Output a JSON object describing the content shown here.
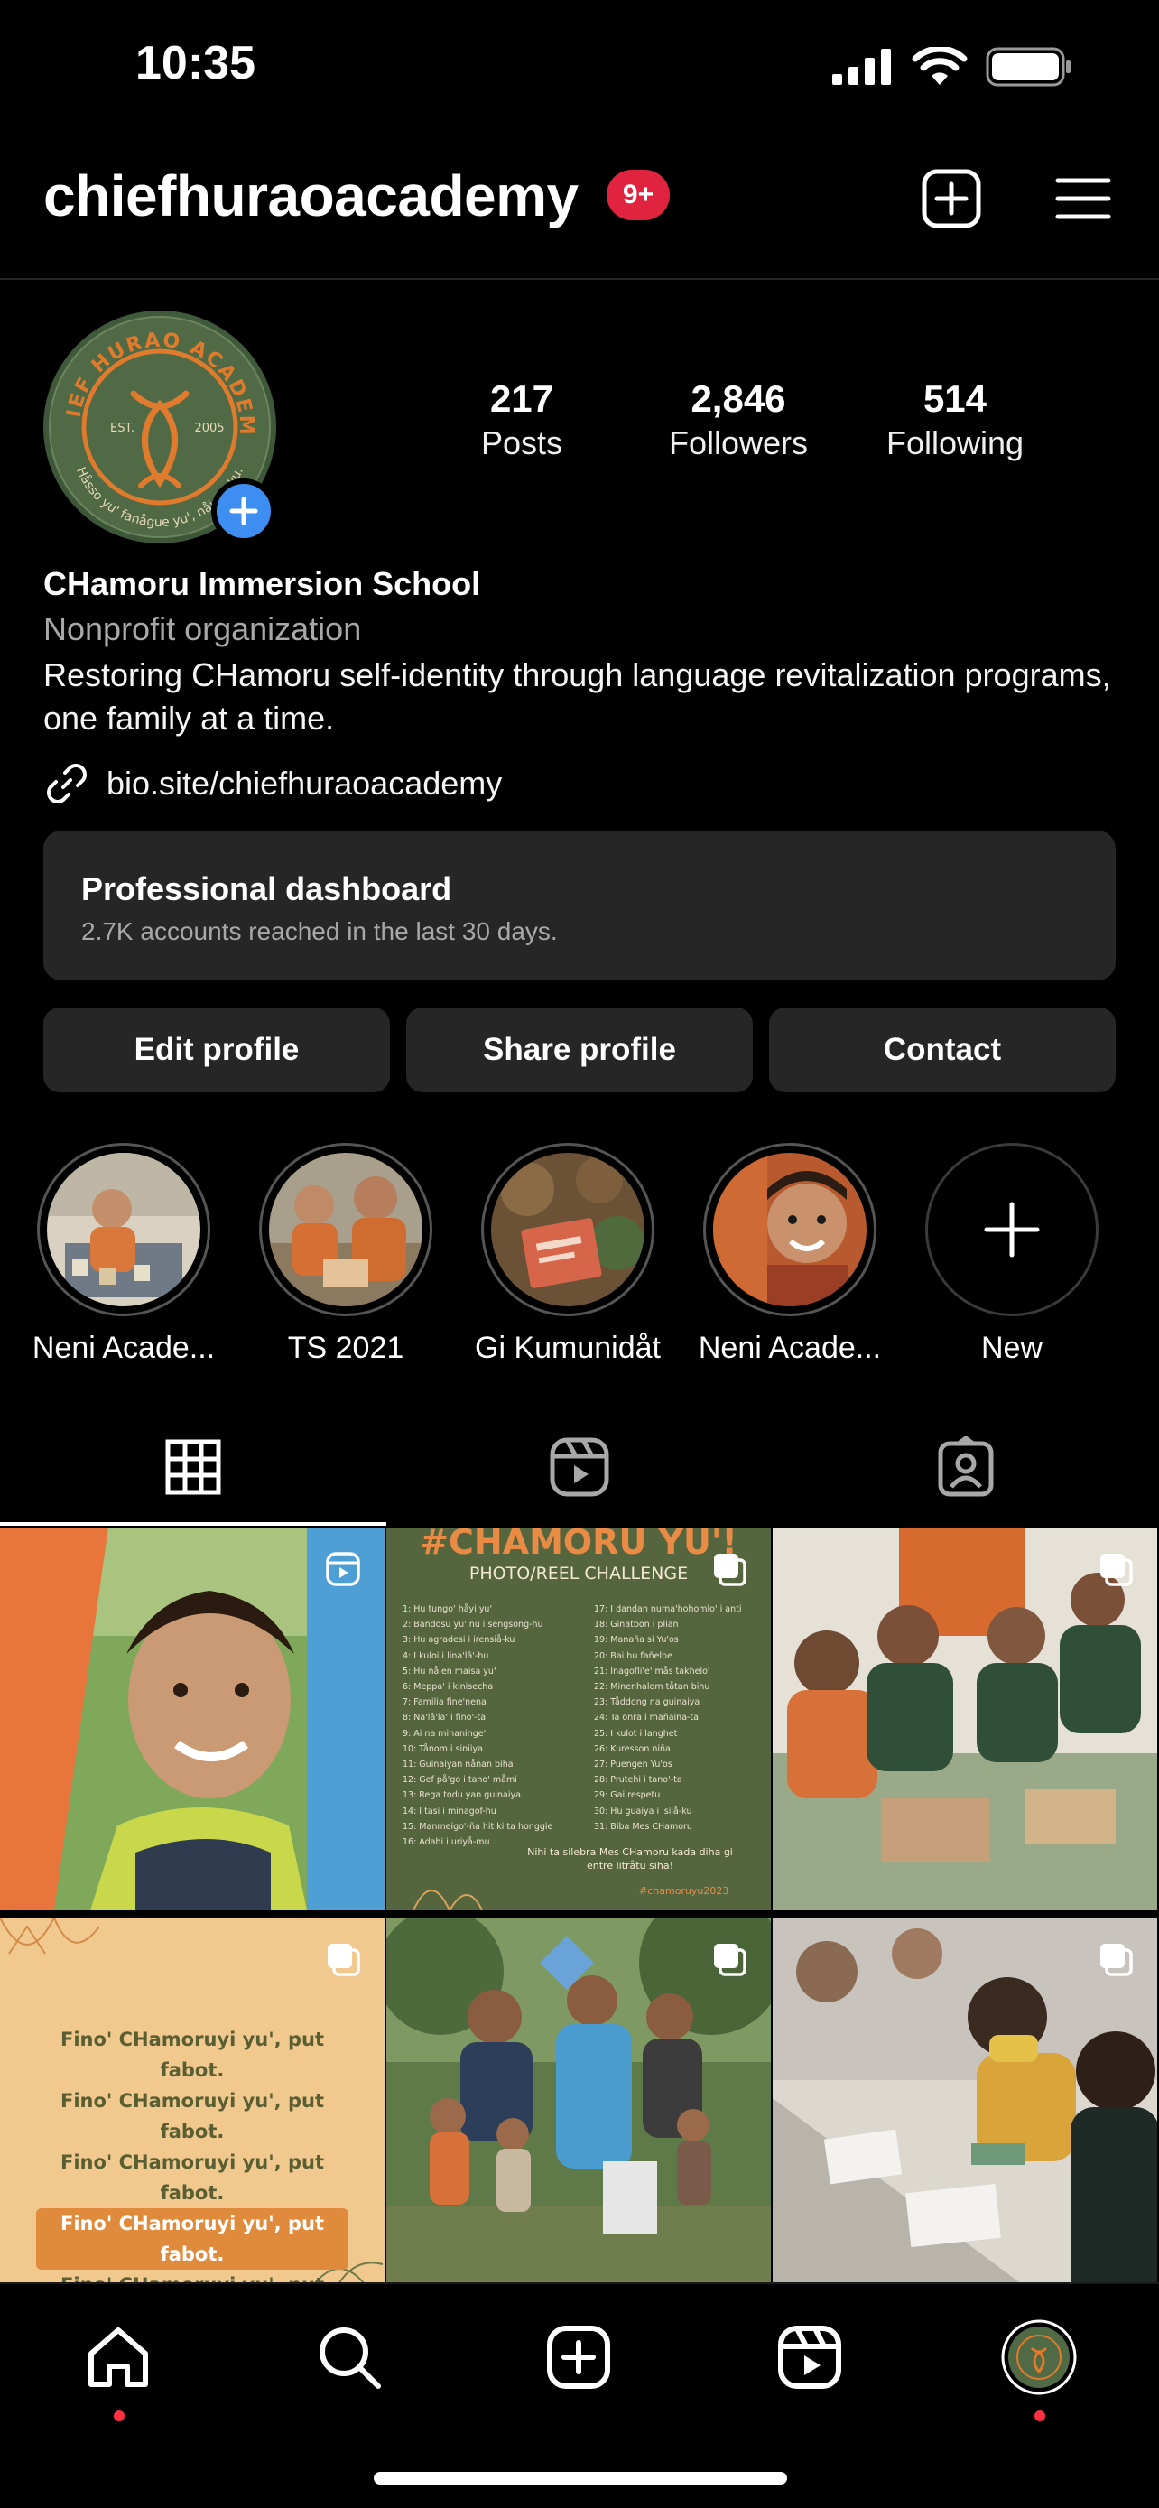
{
  "status_bar": {
    "time": "10:35"
  },
  "header": {
    "username": "chiefhuraoacademy",
    "notification_badge": "9+",
    "badge_color": "#e0243f"
  },
  "profile": {
    "avatar_text_top": "CHIEF HURAO ACADEMY",
    "avatar_est": "EST.",
    "avatar_year": "2005",
    "avatar_text_bottom": "Håsso yu' fanågue yu', nåi yu'-ku.",
    "stats": [
      {
        "value": "217",
        "label": "Posts"
      },
      {
        "value": "2,846",
        "label": "Followers"
      },
      {
        "value": "514",
        "label": "Following"
      }
    ],
    "name": "CHamoru Immersion School",
    "category": "Nonprofit organization",
    "bio": "Restoring CHamoru self-identity through language revitalization programs, one family at a time.",
    "link": "bio.site/chiefhuraoacademy"
  },
  "dashboard": {
    "title": "Professional dashboard",
    "subtitle": "2.7K accounts reached in the last 30 days."
  },
  "actions": [
    "Edit profile",
    "Share profile",
    "Contact"
  ],
  "highlights": [
    {
      "label": "Neni Acade..."
    },
    {
      "label": "TS 2021"
    },
    {
      "label": "Gi Kumunidåt"
    },
    {
      "label": "Neni Acade..."
    },
    {
      "label": "New"
    }
  ],
  "tabs": [
    "grid-icon",
    "reels-icon",
    "tagged-icon"
  ],
  "grid": {
    "post2": {
      "title": "#CHAMORU YU'!",
      "subtitle": "PHOTO/REEL CHALLENGE",
      "list_left": [
        "1: Hu tungo' håyi yu'",
        "2: Bandosu yu' nu i sengsong-hu",
        "3: Hu agradesi i irensiå-ku",
        "4: I kuloi i lina'lâ'-hu",
        "5: Hu nå'en maisa yu'",
        "6: Meppa' i kinisecha",
        "7: Familia fine'nena",
        "8: Na'lâ'la' i fino'-ta",
        "9: Ai na minaninge'",
        "10: Tånom i siniiya",
        "11: Guinaiyan nånan biha",
        "12: Gef på'go i tano' måmi",
        "13: Rega todu yan guinaiya",
        "14: I tasi i minagof-hu",
        "15: Manmeigo'-ña hit ki ta honggie",
        "16: Adahi i uriyå-mu"
      ],
      "list_right": [
        "17: I dandan numa'hohomlo' i anti",
        "18: Ginatbon i plian",
        "19: Manaña si Yu'os",
        "20: Bai hu fañelbe",
        "21: Inagofli'e' mås takhelo'",
        "22: Minenhalom tåtan bihu",
        "23: Tåddong na guinaiya",
        "24: Ta onra i mañaina-ta",
        "25: I kulot i langhet",
        "26: Kuresson niña",
        "27: Puengen Yu'os",
        "28: Prutehi i tano'-ta",
        "29: Gai respetu",
        "30: Hu guaiya i isilå-ku",
        "31: Biba Mes CHamoru"
      ],
      "footer": "Nihi ta silebra Mes CHamoru kada diha gi entre litråtu siha!",
      "hashtag": "#chamoruyu2023"
    },
    "post4_lines": [
      "Fino' CHamoruyi yu', put fabot.",
      "Fino' CHamoruyi yu', put fabot.",
      "Fino' CHamoruyi yu', put fabot.",
      "Fino' CHamoruyi yu', put fabot.",
      "Fino' CHamoruyi yu', put fabot."
    ],
    "post4_highlight_index": 3
  },
  "bottom_nav": [
    "home-icon",
    "search-icon",
    "create-icon",
    "reels-icon",
    "profile-avatar"
  ],
  "colors": {
    "accent_blue": "#3d8ef0",
    "notification_red": "#ff3040",
    "surface": "#262626",
    "brand_green": "#4f6a45",
    "brand_orange": "#e07a2c"
  }
}
